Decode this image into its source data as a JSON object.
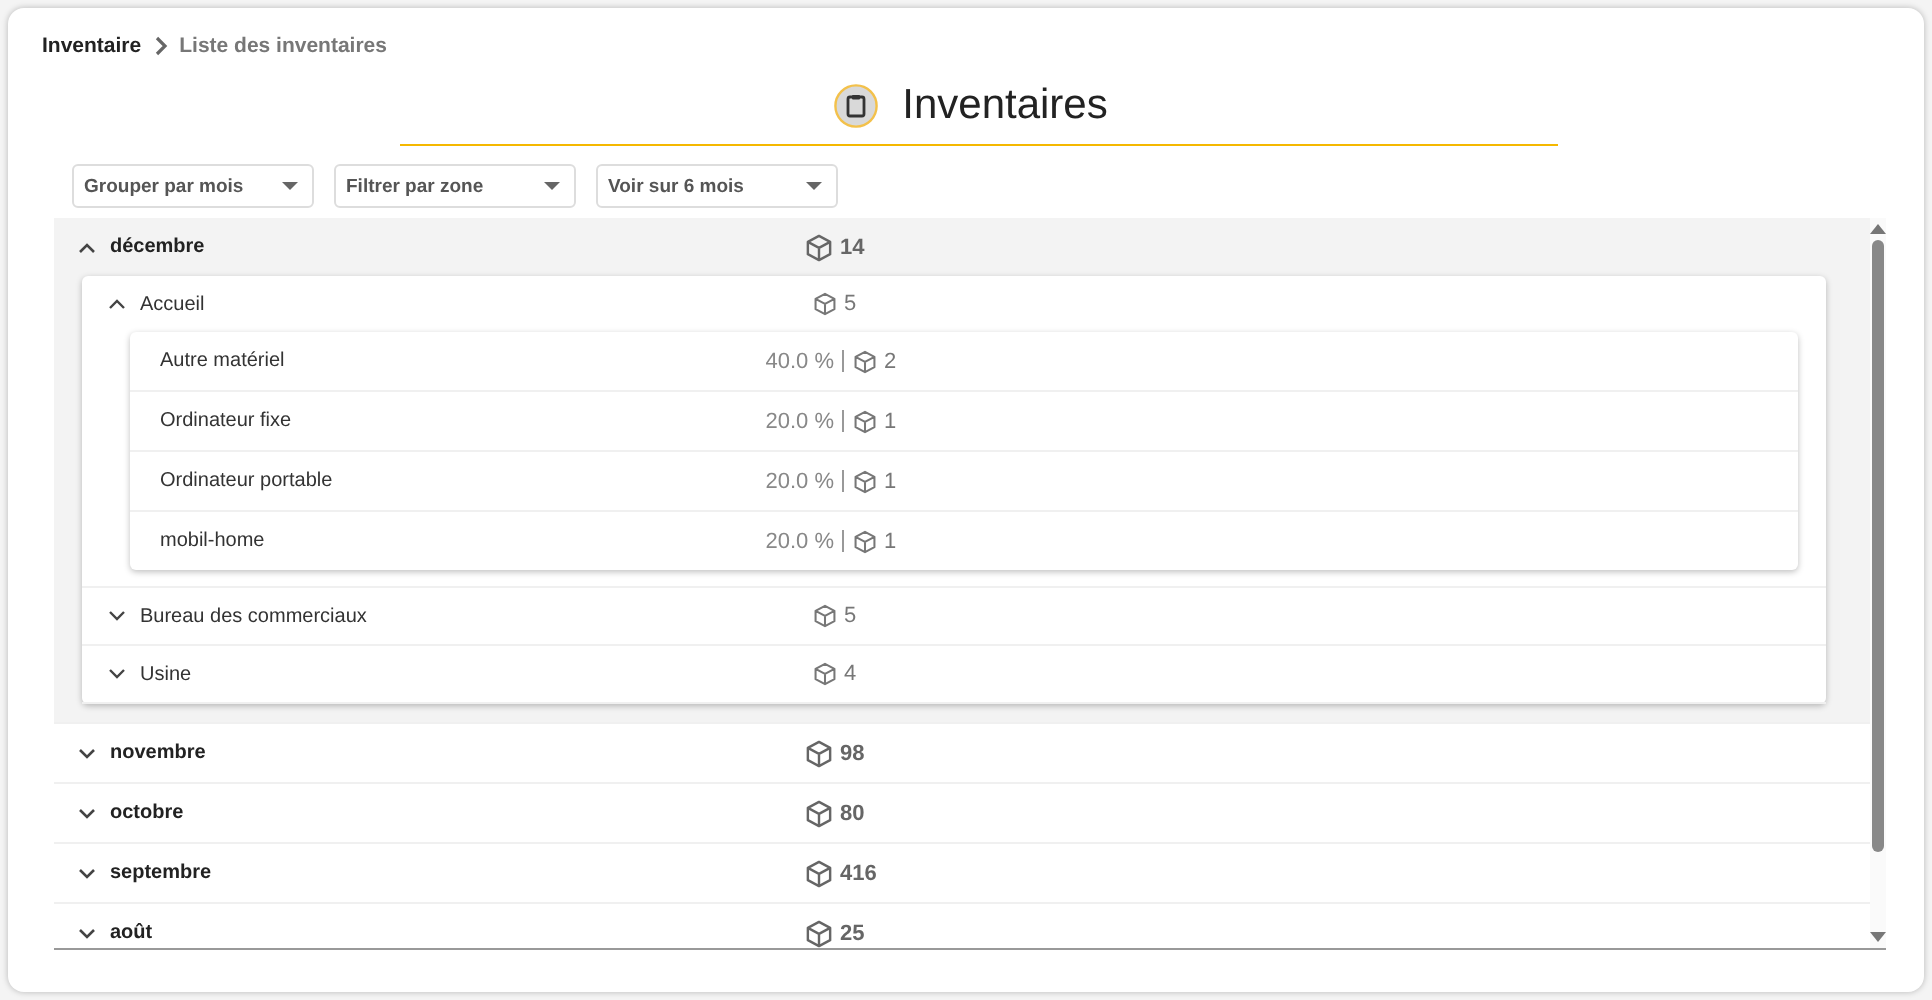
{
  "breadcrumb": [
    {
      "label": "Inventaire",
      "current": false
    },
    {
      "label": "Liste des inventaires",
      "current": true
    }
  ],
  "page_title": "Inventaires",
  "filters": [
    {
      "label": "Grouper par mois"
    },
    {
      "label": "Filtrer par zone"
    },
    {
      "label": "Voir sur 6 mois"
    }
  ],
  "months": [
    {
      "name": "décembre",
      "count": "14",
      "expanded": true,
      "zones": [
        {
          "name": "Accueil",
          "count": "5",
          "expanded": true,
          "categories": [
            {
              "name": "Autre matériel",
              "share": "40.0 %",
              "count": "2"
            },
            {
              "name": "Ordinateur fixe",
              "share": "20.0 %",
              "count": "1"
            },
            {
              "name": "Ordinateur portable",
              "share": "20.0 %",
              "count": "1"
            },
            {
              "name": "mobil-home",
              "share": "20.0 %",
              "count": "1"
            }
          ]
        },
        {
          "name": "Bureau des commerciaux",
          "count": "5",
          "expanded": false
        },
        {
          "name": "Usine",
          "count": "4",
          "expanded": false
        }
      ]
    },
    {
      "name": "novembre",
      "count": "98",
      "expanded": false
    },
    {
      "name": "octobre",
      "count": "80",
      "expanded": false
    },
    {
      "name": "septembre",
      "count": "416",
      "expanded": false
    },
    {
      "name": "août",
      "count": "25",
      "expanded": false
    }
  ]
}
